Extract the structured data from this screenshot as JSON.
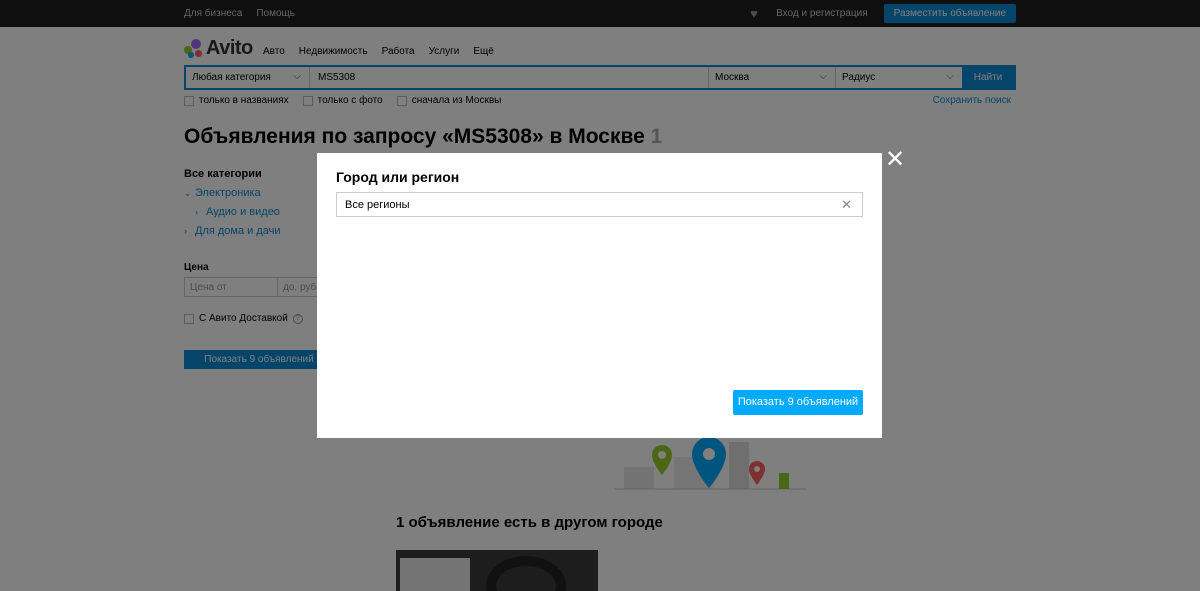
{
  "topbar": {
    "business": "Для бизнеса",
    "help": "Помощь",
    "login": "Вход и регистрация",
    "post_ad": "Разместить объявление"
  },
  "header": {
    "logo_text": "Avito",
    "nav": [
      "Авто",
      "Недвижимость",
      "Работа",
      "Услуги",
      "Ещё"
    ]
  },
  "search": {
    "category": "Любая категория",
    "query": "MS5308",
    "city": "Москва",
    "radius": "Радиус",
    "submit": "Найти",
    "filters": [
      "только в названиях",
      "только с фото",
      "сначала из Москвы"
    ],
    "save": "Сохранить поиск"
  },
  "page": {
    "title": "Объявления по запросу «MS5308» в Москве",
    "count": "1"
  },
  "sidebar": {
    "heading": "Все категории",
    "categories": [
      "Электроника",
      "Аудио и видео",
      "Для дома и дачи"
    ],
    "price_label": "Цена",
    "price_from": "Цена от",
    "price_to": "до, руб.",
    "delivery": "С Авито Доставкой",
    "show_button": "Показать 9 объявлений"
  },
  "results": {
    "other_city_title": "1 объявление есть в другом городе"
  },
  "modal": {
    "title": "Город или регион",
    "region_value": "Все регионы",
    "show_button": "Показать 9 объявлений"
  }
}
